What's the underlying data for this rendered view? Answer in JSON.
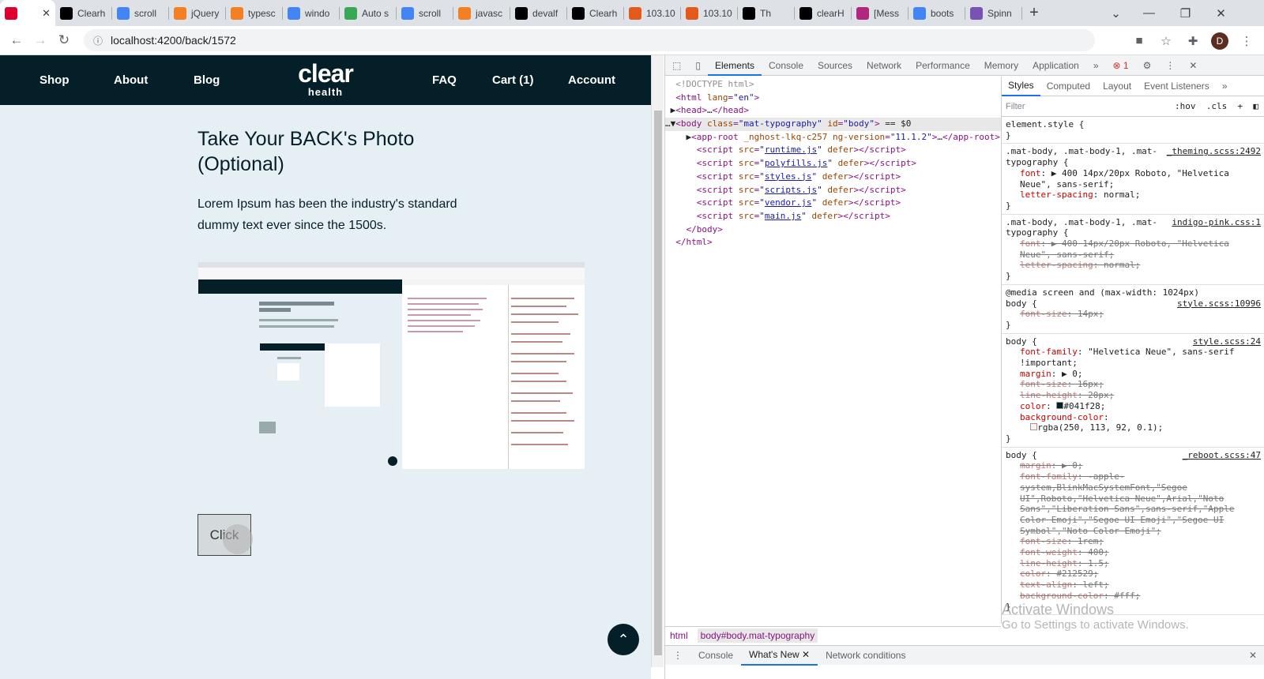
{
  "browser": {
    "tabs": [
      {
        "label": "",
        "icon": "angular-icon",
        "color": "#dd0031",
        "active": true
      },
      {
        "label": "Clearh",
        "icon": "angular-black-icon",
        "color": "#000000"
      },
      {
        "label": "scroll",
        "icon": "google-icon",
        "color": "#4285f4"
      },
      {
        "label": "jQuery",
        "icon": "stackoverflow-icon",
        "color": "#f48024"
      },
      {
        "label": "typesc",
        "icon": "stackoverflow-icon",
        "color": "#f48024"
      },
      {
        "label": "windo",
        "icon": "google-icon",
        "color": "#4285f4"
      },
      {
        "label": "Auto s",
        "icon": "tool-icon",
        "color": "#3aa757"
      },
      {
        "label": "scroll",
        "icon": "google-icon",
        "color": "#4285f4"
      },
      {
        "label": "javasc",
        "icon": "stackoverflow-icon",
        "color": "#f48024"
      },
      {
        "label": "devalf",
        "icon": "github-icon",
        "color": "#000000"
      },
      {
        "label": "Clearh",
        "icon": "angular-black-icon",
        "color": "#000000"
      },
      {
        "label": "103.10",
        "icon": "server-icon",
        "color": "#e25a1c"
      },
      {
        "label": "103.10",
        "icon": "server-icon",
        "color": "#e25a1c"
      },
      {
        "label": "Th",
        "icon": "angular-black-icon",
        "color": "#000000"
      },
      {
        "label": "clearH",
        "icon": "angular-black-icon",
        "color": "#000000"
      },
      {
        "label": "[Mess",
        "icon": "chat-icon",
        "color": "#b0277c"
      },
      {
        "label": "boots",
        "icon": "google-icon",
        "color": "#4285f4"
      },
      {
        "label": "Spinn",
        "icon": "bootstrap-icon",
        "color": "#7952b3"
      }
    ],
    "url": "localhost:4200/back/1572",
    "profile_initial": "D"
  },
  "site": {
    "nav": {
      "shop": "Shop",
      "about": "About",
      "blog": "Blog",
      "faq": "FAQ",
      "cart": "Cart (1)",
      "account": "Account"
    },
    "logo": {
      "main": "clear",
      "sub": "health"
    },
    "title": "Take Your BACK's Photo (Optional)",
    "description": "Lorem Ipsum has been the industry's standard dummy text ever since the 1500s.",
    "button": "Click"
  },
  "devtools": {
    "tabs": [
      "Elements",
      "Console",
      "Sources",
      "Network",
      "Performance",
      "Memory",
      "Application"
    ],
    "error_count": "1",
    "style_tabs": [
      "Styles",
      "Computed",
      "Layout",
      "Event Listeners"
    ],
    "filter_placeholder": "Filter",
    "filter_hov": ":hov",
    "filter_cls": ".cls",
    "breadcrumb": [
      "html",
      "body#body.mat-typography"
    ],
    "drawer_tabs": [
      "Console",
      "What's New",
      "Network conditions"
    ]
  },
  "watermark": {
    "line1": "Activate Windows",
    "line2": "Go to Settings to activate Windows."
  },
  "colors": {
    "brand_dark": "#041f28",
    "page_bg": "#e6f0f4"
  }
}
